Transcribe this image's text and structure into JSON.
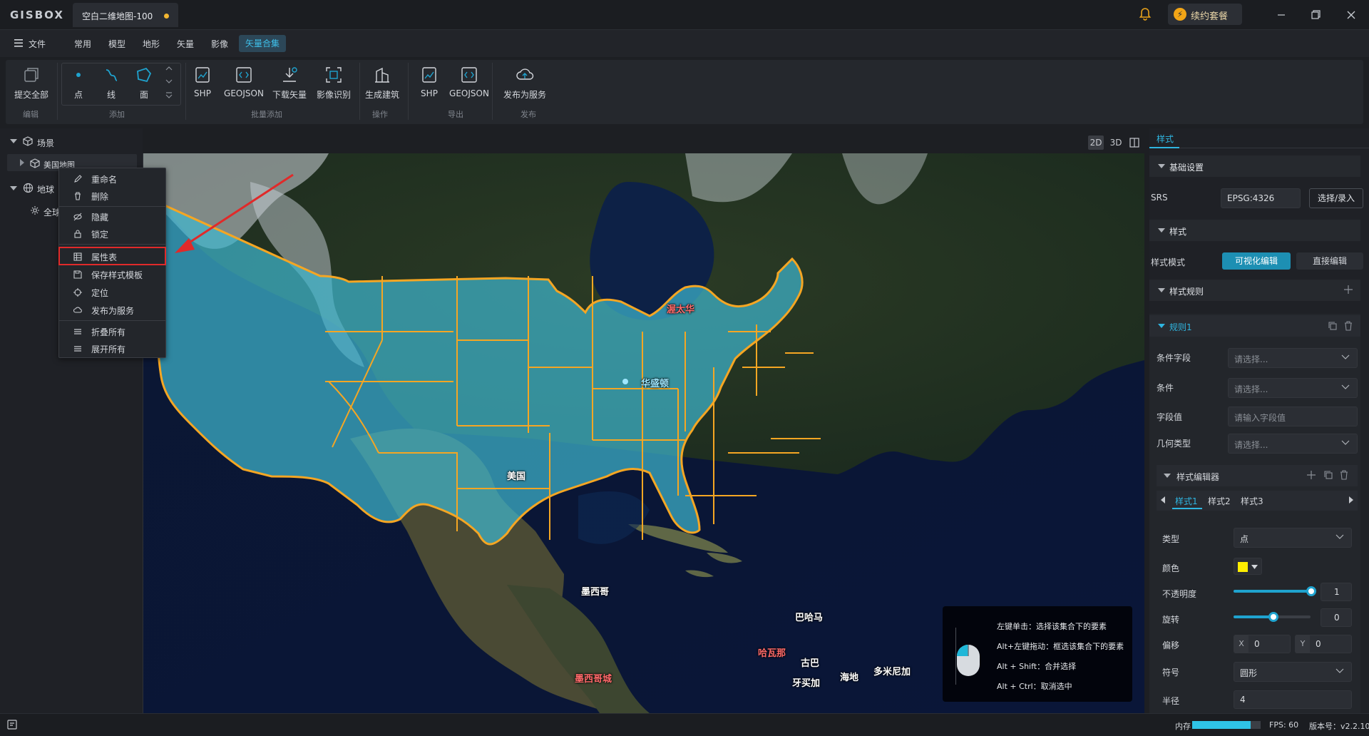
{
  "titlebar": {
    "logo": "GISBOX",
    "tab_title": "空白二维地图-100",
    "renew_label": "续约套餐"
  },
  "menubar": {
    "file": "文件",
    "items": [
      "常用",
      "模型",
      "地形",
      "矢量",
      "影像",
      "矢量合集"
    ],
    "active": "矢量合集"
  },
  "toolbar": {
    "tools": {
      "submit_all": "提交全部",
      "point": "点",
      "line": "线",
      "polygon": "面",
      "shp_add": "SHP",
      "geojson_add": "GEOJSON",
      "download_vector": "下载矢量",
      "image_recognition": "影像识别",
      "generate_building": "生成建筑",
      "shp_export": "SHP",
      "geojson_export": "GEOJSON",
      "publish_service": "发布为服务"
    },
    "groups": {
      "edit": "编辑",
      "add": "添加",
      "batch_add": "批量添加",
      "operate": "操作",
      "export": "导出",
      "publish": "发布"
    }
  },
  "scene_tree": {
    "scene_label": "场景",
    "layer_label": "美国地图",
    "earth_label": "地球",
    "global_label": "全球"
  },
  "context_menu": {
    "items": [
      "重命名",
      "删除",
      "隐藏",
      "锁定",
      "属性表",
      "保存样式模板",
      "定位",
      "发布为服务",
      "折叠所有",
      "展开所有"
    ],
    "highlighted": "属性表"
  },
  "view_modes": [
    "2D",
    "3D"
  ],
  "map": {
    "labels": {
      "usa": "美国",
      "ottawa": "渥太华",
      "washington": "华盛顿",
      "mexico": "墨西哥",
      "mexico_city": "墨西哥城",
      "bahamas": "巴哈马",
      "havana": "哈瓦那",
      "cuba": "古巴",
      "jamaica": "牙买加",
      "haiti": "海地",
      "dominican": "多米尼加"
    },
    "hint": [
      "左键单击：选择该集合下的要素",
      "Alt+左键拖动：框选该集合下的要素",
      "Alt + Shift：合并选择",
      "Alt + Ctrl：取消选中"
    ]
  },
  "right_panel": {
    "tab": "样式",
    "basic_section": "基础设置",
    "srs_label": "SRS",
    "srs_value": "EPSG:4326",
    "srs_button": "选择/录入",
    "style_section": "样式",
    "style_mode_label": "样式模式",
    "mode_visual": "可视化编辑",
    "mode_direct": "直接编辑",
    "rules_section": "样式规则",
    "rule1": "规则1",
    "cond_field_label": "条件字段",
    "cond_field_placeholder": "请选择...",
    "condition_label": "条件",
    "condition_placeholder": "请选择...",
    "field_value_label": "字段值",
    "field_value_placeholder": "请输入字段值",
    "geom_type_label": "几何类型",
    "geom_type_placeholder": "请选择...",
    "style_editor_section": "样式编辑器",
    "style_tabs": [
      "样式1",
      "样式2",
      "样式3"
    ],
    "type_label": "类型",
    "type_value": "点",
    "color_label": "颜色",
    "color_value": "#ffee00",
    "opacity_label": "不透明度",
    "opacity_value": "1",
    "rotation_label": "旋转",
    "rotation_value": "0",
    "offset_label": "偏移",
    "offset_x_label": "X",
    "offset_x_value": "0",
    "offset_y_label": "Y",
    "offset_y_value": "0",
    "symbol_label": "符号",
    "symbol_value": "圆形",
    "radius_label": "半径",
    "radius_value": "4"
  },
  "statusbar": {
    "memory_label": "内存",
    "memory_fraction": 0.85,
    "fps": "FPS: 60",
    "version": "版本号：v2.2.10"
  },
  "colors": {
    "accent": "#1fa3cf",
    "state_fill": "#3fb8d0",
    "state_border": "#f5a623",
    "highlight_red": "#e02a2a"
  }
}
